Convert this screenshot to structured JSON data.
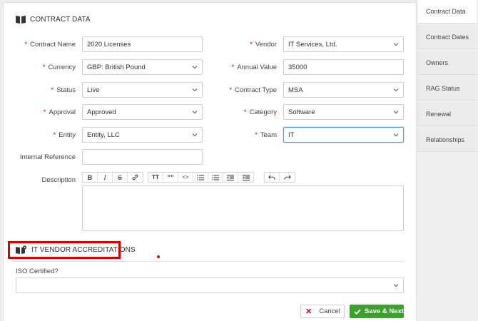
{
  "section_contract": {
    "title": "CONTRACT DATA"
  },
  "fields": {
    "contract_name": {
      "label": "Contract Name",
      "value": "2020 Licenses"
    },
    "vendor": {
      "label": "Vendor",
      "value": "IT Services, Ltd."
    },
    "currency": {
      "label": "Currency",
      "value": "GBP: British Pound"
    },
    "annual_value": {
      "label": "Annual Value",
      "value": "35000"
    },
    "status": {
      "label": "Status",
      "value": "Live"
    },
    "contract_type": {
      "label": "Contract Type",
      "value": "MSA"
    },
    "approval": {
      "label": "Approval",
      "value": "Approved"
    },
    "category": {
      "label": "Category",
      "value": "Software"
    },
    "entity": {
      "label": "Entity",
      "value": "Entity, LLC"
    },
    "team": {
      "label": "Team",
      "value": "IT"
    },
    "internal_reference": {
      "label": "Internal Reference",
      "value": ""
    },
    "description": {
      "label": "Description"
    }
  },
  "required_marker": "*",
  "toolbar": {
    "bold": "B",
    "italic": "I",
    "strike": "S",
    "heading": "TT",
    "quote": "””",
    "code": "<>"
  },
  "section_it": {
    "title": "IT VENDOR ACCREDITATIONS"
  },
  "iso": {
    "label": "ISO Certified?",
    "value": ""
  },
  "buttons": {
    "cancel": "Cancel",
    "save": "Save & Next"
  },
  "sidebar": {
    "tabs": [
      {
        "label": "Contract Data",
        "active": true
      },
      {
        "label": "Contract Dates"
      },
      {
        "label": "Owners"
      },
      {
        "label": "RAG Status"
      },
      {
        "label": "Renewal"
      },
      {
        "label": "Relationships"
      }
    ]
  },
  "colors": {
    "required": "#d0021b",
    "save_button": "#3aa12c",
    "highlight": "#d50000"
  }
}
